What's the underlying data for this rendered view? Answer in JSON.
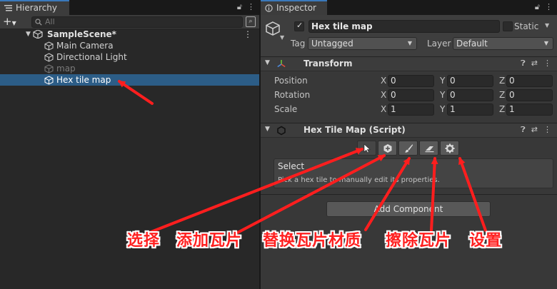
{
  "hierarchy": {
    "tab_label": "Hierarchy",
    "search_placeholder": "All",
    "scene": "SampleScene*",
    "items": [
      {
        "label": "Main Camera"
      },
      {
        "label": "Directional Light"
      },
      {
        "label": "map"
      },
      {
        "label": "Hex tile map"
      }
    ]
  },
  "inspector": {
    "tab_label": "Inspector",
    "object_name": "Hex tile map",
    "static_label": "Static",
    "tag_label": "Tag",
    "tag_value": "Untagged",
    "layer_label": "Layer",
    "layer_value": "Default",
    "transform": {
      "title": "Transform",
      "rows": [
        {
          "label": "Position",
          "x": "0",
          "y": "0",
          "z": "0"
        },
        {
          "label": "Rotation",
          "x": "0",
          "y": "0",
          "z": "0"
        },
        {
          "label": "Scale",
          "x": "1",
          "y": "1",
          "z": "1"
        }
      ],
      "axis": {
        "x": "X",
        "y": "Y",
        "z": "Z"
      }
    },
    "script": {
      "title": "Hex Tile Map (Script)",
      "tools": [
        "select",
        "add",
        "paint",
        "erase",
        "settings"
      ],
      "info_title": "Select",
      "info_desc": "Pick a hex tile to manually edit its properties."
    },
    "add_component": "Add Component"
  },
  "annotations": {
    "select": "选择",
    "add": "添加瓦片",
    "replace": "替换瓦片材质",
    "erase": "擦除瓦片",
    "settings": "设置"
  },
  "colors": {
    "selection": "#2c5d87",
    "annotation": "#ff2020",
    "tab_accent": "#3a79bb"
  }
}
